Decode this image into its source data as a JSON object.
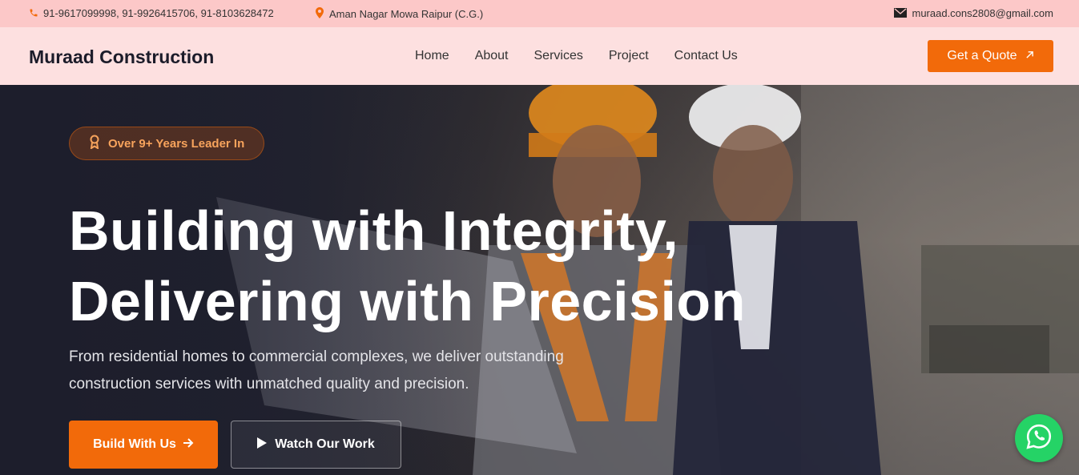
{
  "topbar": {
    "phones": "91-9617099998,  91-9926415706,  91-8103628472",
    "address": "Aman Nagar Mowa Raipur (C.G.)",
    "email": "muraad.cons2808@gmail.com"
  },
  "navbar": {
    "brand": "Muraad Construction",
    "links": [
      "Home",
      "About",
      "Services",
      "Project",
      "Contact Us"
    ],
    "cta_label": "Get a Quote"
  },
  "hero": {
    "badge": "Over 9+ Years Leader In",
    "headline_line1": "Building with Integrity,",
    "headline_line2": "Delivering with Precision",
    "subtext_line1": "From residential homes to commercial complexes, we deliver outstanding",
    "subtext_line2": "construction services with unmatched quality and precision.",
    "primary_button": "Build With Us",
    "secondary_button": "Watch Our Work"
  },
  "colors": {
    "accent": "#f26a0a",
    "topbar_bg": "#fcc8c8",
    "navbar_bg": "#fde0e0",
    "whatsapp": "#25d366"
  },
  "icons": [
    "phone-icon",
    "location-pin-icon",
    "envelope-icon",
    "arrow-up-right-icon",
    "award-icon",
    "arrow-right-icon",
    "play-icon",
    "whatsapp-icon"
  ]
}
